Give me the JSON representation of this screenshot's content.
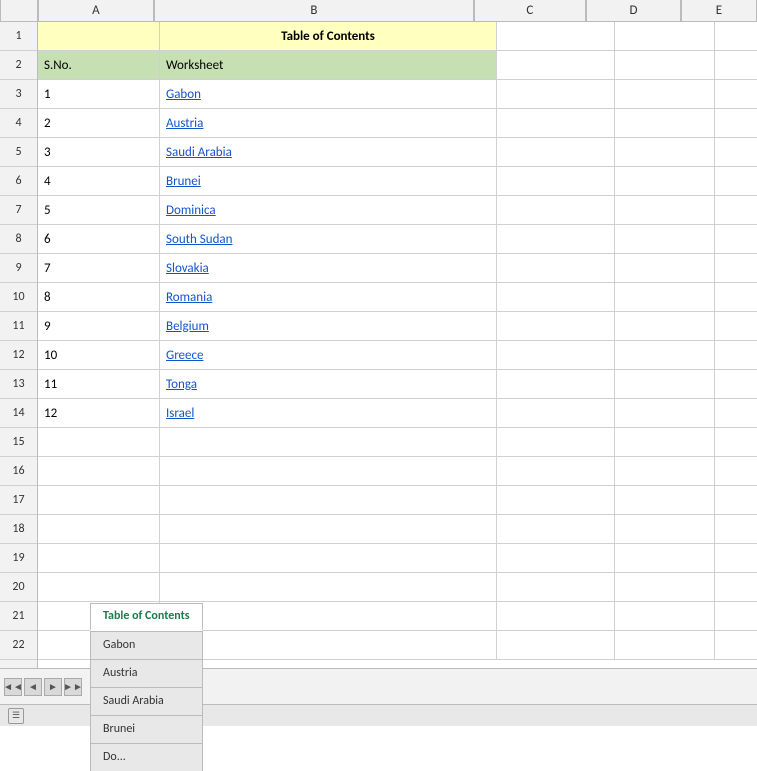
{
  "columns": {
    "headers": [
      "A",
      "B",
      "C",
      "D",
      "E"
    ],
    "row_num_header": ""
  },
  "rows": [
    {
      "num": "1",
      "cells": {
        "a": "",
        "b": "Table of Contents",
        "c": "",
        "d": "",
        "e": ""
      },
      "type": "title"
    },
    {
      "num": "2",
      "cells": {
        "a": "S.No.",
        "b": "Worksheet",
        "c": "",
        "d": "",
        "e": ""
      },
      "type": "header"
    },
    {
      "num": "3",
      "cells": {
        "a": "1",
        "b": "Gabon",
        "c": "",
        "d": "",
        "e": ""
      },
      "type": "data"
    },
    {
      "num": "4",
      "cells": {
        "a": "2",
        "b": "Austria",
        "c": "",
        "d": "",
        "e": ""
      },
      "type": "data"
    },
    {
      "num": "5",
      "cells": {
        "a": "3",
        "b": "Saudi Arabia",
        "c": "",
        "d": "",
        "e": ""
      },
      "type": "data"
    },
    {
      "num": "6",
      "cells": {
        "a": "4",
        "b": "Brunei",
        "c": "",
        "d": "",
        "e": ""
      },
      "type": "data"
    },
    {
      "num": "7",
      "cells": {
        "a": "5",
        "b": "Dominica",
        "c": "",
        "d": "",
        "e": ""
      },
      "type": "data"
    },
    {
      "num": "8",
      "cells": {
        "a": "6",
        "b": "South Sudan",
        "c": "",
        "d": "",
        "e": ""
      },
      "type": "data"
    },
    {
      "num": "9",
      "cells": {
        "a": "7",
        "b": "Slovakia",
        "c": "",
        "d": "",
        "e": ""
      },
      "type": "data"
    },
    {
      "num": "10",
      "cells": {
        "a": "8",
        "b": "Romania",
        "c": "",
        "d": "",
        "e": ""
      },
      "type": "data"
    },
    {
      "num": "11",
      "cells": {
        "a": "9",
        "b": "Belgium",
        "c": "",
        "d": "",
        "e": ""
      },
      "type": "data"
    },
    {
      "num": "12",
      "cells": {
        "a": "10",
        "b": "Greece",
        "c": "",
        "d": "",
        "e": ""
      },
      "type": "data"
    },
    {
      "num": "13",
      "cells": {
        "a": "11",
        "b": "Tonga",
        "c": "",
        "d": "",
        "e": ""
      },
      "type": "data"
    },
    {
      "num": "14",
      "cells": {
        "a": "12",
        "b": "Israel",
        "c": "",
        "d": "",
        "e": ""
      },
      "type": "data"
    },
    {
      "num": "15",
      "cells": {
        "a": "",
        "b": "",
        "c": "",
        "d": "",
        "e": ""
      },
      "type": "empty"
    },
    {
      "num": "16",
      "cells": {
        "a": "",
        "b": "",
        "c": "",
        "d": "",
        "e": ""
      },
      "type": "empty"
    },
    {
      "num": "17",
      "cells": {
        "a": "",
        "b": "",
        "c": "",
        "d": "",
        "e": ""
      },
      "type": "empty"
    },
    {
      "num": "18",
      "cells": {
        "a": "",
        "b": "",
        "c": "",
        "d": "",
        "e": ""
      },
      "type": "empty"
    },
    {
      "num": "19",
      "cells": {
        "a": "",
        "b": "",
        "c": "",
        "d": "",
        "e": ""
      },
      "type": "empty"
    },
    {
      "num": "20",
      "cells": {
        "a": "",
        "b": "",
        "c": "",
        "d": "",
        "e": ""
      },
      "type": "empty"
    },
    {
      "num": "21",
      "cells": {
        "a": "",
        "b": "",
        "c": "",
        "d": "",
        "e": ""
      },
      "type": "empty"
    },
    {
      "num": "22",
      "cells": {
        "a": "",
        "b": "",
        "c": "",
        "d": "",
        "e": ""
      },
      "type": "empty"
    }
  ],
  "tabs": [
    {
      "label": "Table of Contents",
      "active": true
    },
    {
      "label": "Gabon",
      "active": false
    },
    {
      "label": "Austria",
      "active": false
    },
    {
      "label": "Saudi Arabia",
      "active": false
    },
    {
      "label": "Brunei",
      "active": false
    },
    {
      "label": "Do...",
      "active": false
    }
  ],
  "nav_buttons": [
    "◄◄",
    "◄",
    "►",
    "►►"
  ],
  "status": ""
}
